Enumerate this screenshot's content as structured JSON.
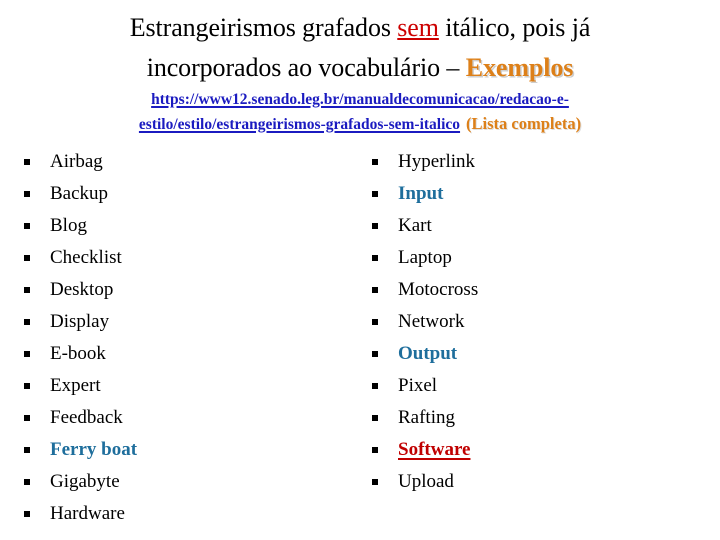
{
  "title": {
    "line1_prefix": "Estrangeirismos grafados ",
    "line1_keyword": "sem",
    "line1_suffix": " itálico, pois já",
    "line2_prefix": "incorporados ao vocabulário – ",
    "line2_keyword": "Exemplos"
  },
  "link": {
    "url_line1": "https://www12.senado.leg.br/manualdecomunicacao/redacao-e-",
    "url_line2": "estilo/estilo/estrangeirismos-grafados-sem-italico",
    "note": "(Lista completa)"
  },
  "colors": {
    "keyword_red": "#CC0000",
    "keyword_orange": "#DD8019",
    "link_blue": "#1B1BC0",
    "highlight_blue": "#1E6E9C",
    "highlight_red": "#C00000",
    "text_black": "#000000"
  },
  "columns": {
    "left": [
      {
        "label": "Airbag",
        "style": "normal"
      },
      {
        "label": "Backup",
        "style": "normal"
      },
      {
        "label": "Blog",
        "style": "normal"
      },
      {
        "label": "Checklist",
        "style": "normal"
      },
      {
        "label": "Desktop",
        "style": "normal"
      },
      {
        "label": "Display",
        "style": "normal"
      },
      {
        "label": "E-book",
        "style": "normal"
      },
      {
        "label": "Expert",
        "style": "normal"
      },
      {
        "label": "Feedback",
        "style": "normal"
      },
      {
        "label": "Ferry boat",
        "style": "hl-blue"
      },
      {
        "label": "Gigabyte",
        "style": "normal"
      },
      {
        "label": "Hardware",
        "style": "normal"
      }
    ],
    "right": [
      {
        "label": "Hyperlink",
        "style": "normal"
      },
      {
        "label": "Input",
        "style": "hl-blue"
      },
      {
        "label": "Kart",
        "style": "normal"
      },
      {
        "label": "Laptop",
        "style": "normal"
      },
      {
        "label": "Motocross",
        "style": "normal"
      },
      {
        "label": "Network",
        "style": "normal"
      },
      {
        "label": "Output",
        "style": "hl-blue"
      },
      {
        "label": "Pixel",
        "style": "normal"
      },
      {
        "label": "Rafting",
        "style": "normal"
      },
      {
        "label": "Software",
        "style": "hl-red"
      },
      {
        "label": "Upload",
        "style": "normal"
      }
    ]
  }
}
